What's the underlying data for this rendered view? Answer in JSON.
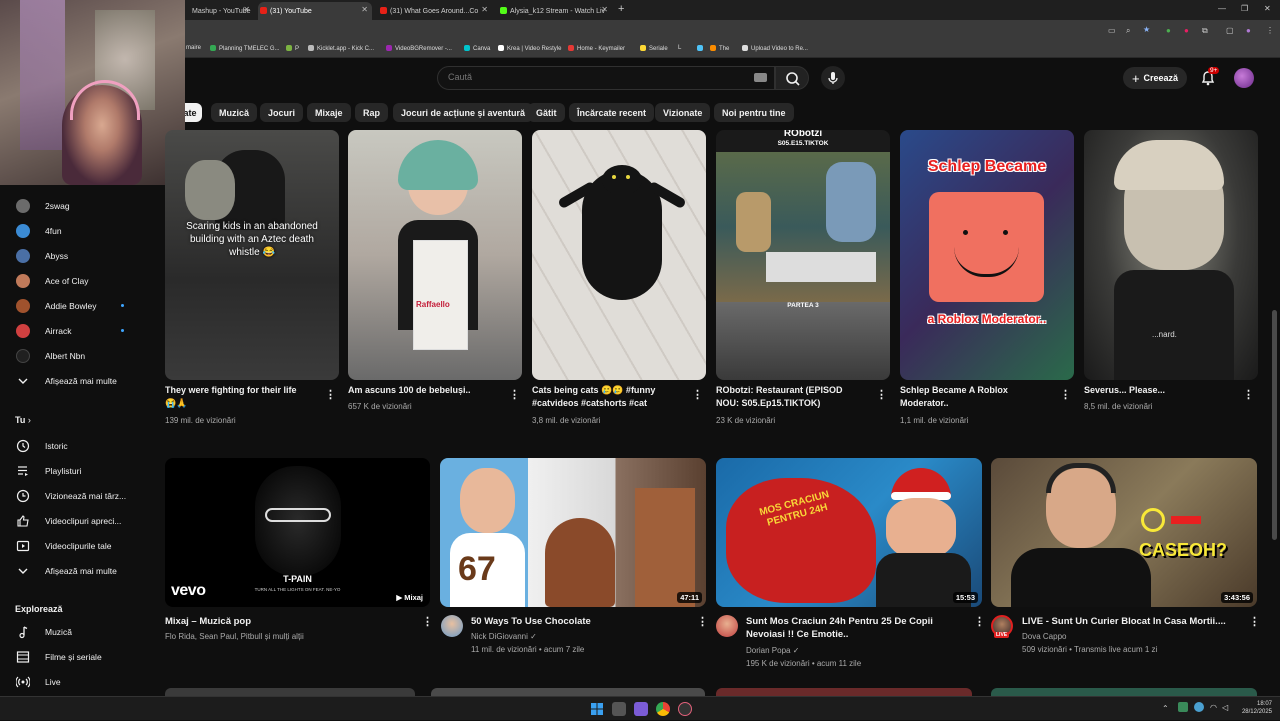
{
  "browser": {
    "tabs": [
      {
        "label": "Mashup - YouTube",
        "active": false
      },
      {
        "label": "(31) YouTube",
        "active": true
      },
      {
        "label": "(31) What Goes Around...Co",
        "active": false
      },
      {
        "label": "Alysia_k12 Stream - Watch Liv",
        "active": false
      }
    ],
    "new_tab": "+",
    "bookmarks": [
      "maire",
      "Planning TMELEC G...",
      "P",
      "Kicklet.app - Kick C...",
      "VideoBGRemover -...",
      "Canva",
      "Krea | Video Restyle",
      "Home - Keymailer",
      "Seriale",
      "L",
      "The",
      "Upload Video to Re..."
    ]
  },
  "youtube": {
    "search": {
      "placeholder": "Caută"
    },
    "create_label": "Creează",
    "notifications_badge": "9+",
    "chips": [
      "ate",
      "Muzică",
      "Jocuri",
      "Mixaje",
      "Rap",
      "Jocuri de acțiune și aventură",
      "Gătit",
      "Încărcate recent",
      "Vizionate",
      "Noi pentru tine"
    ]
  },
  "sidebar": {
    "subscriptions": [
      {
        "label": "2swag",
        "color": "#6b6b6b",
        "dot": false
      },
      {
        "label": "4fun",
        "color": "#3b8bd4",
        "dot": false
      },
      {
        "label": "Abyss",
        "color": "#4a6fa5",
        "dot": false
      },
      {
        "label": "Ace of Clay",
        "color": "#c07a5a",
        "dot": false
      },
      {
        "label": "Addie Bowley",
        "color": "#a0522d",
        "dot": true
      },
      {
        "label": "Airrack",
        "color": "#d04040",
        "dot": true
      },
      {
        "label": "Albert Nbn",
        "color": "#202020",
        "dot": false
      }
    ],
    "show_more": "Afișează mai multe",
    "you_heading": "Tu",
    "you_items": [
      "Istoric",
      "Playlisturi",
      "Vizionează mai târz...",
      "Videoclipuri apreci...",
      "Videoclipurile tale"
    ],
    "show_more_2": "Afișează mai multe",
    "explore_heading": "Explorează",
    "explore_items": [
      "Muzică",
      "Filme și seriale",
      "Live"
    ]
  },
  "shorts": [
    {
      "title": "They were fighting for their life 😭🙏",
      "views": "139 mil. de vizionări",
      "overlay": "Scaring kids in an abandoned building with an Aztec death whistle 😂"
    },
    {
      "title": "Am ascuns 100 de bebeluși..",
      "views": "657 K de vizionări"
    },
    {
      "title": "Cats being cats 🥲🥲 #funny #catvideos #catshorts #cat",
      "views": "3,8 mil. de vizionări"
    },
    {
      "title": "RObotzi: Restaurant (EPISOD NOU: S05.Ep15.TIKTOK)",
      "views": "23 K de vizionări",
      "overlay_top": "RObotzi",
      "overlay_sub": "S05.E15.TIKTOK",
      "overlay_mid": "PARTEA 3"
    },
    {
      "title": "Schlep Became A Roblox Moderator..",
      "views": "1,1 mil. de vizionări",
      "overlay_top": "Schlep Became",
      "overlay_bottom": "a Roblox Moderator.."
    },
    {
      "title": "Severus... Please...",
      "views": "8,5 mil. de vizionări",
      "overlay": "...nard."
    }
  ],
  "videos": [
    {
      "title": "Mixaj – Muzică pop",
      "line1": "Flo Rida, Sean Paul, Pitbull și mulți alții",
      "line2": "",
      "badge": "Mixaj",
      "thumb_text": "T-PAIN",
      "thumb_sub": "TURN ALL THE LIGHTS ON FEAT. NE-YO",
      "brand": "vevo"
    },
    {
      "title": "50 Ways To Use Chocolate",
      "line1": "Nick DiGiovanni ✓",
      "line2": "11 mil. de vizionări • acum 7 zile",
      "duration": "47:11",
      "thumb_text": "67"
    },
    {
      "title": "Sunt Mos Craciun 24h Pentru 25 De Copii Nevoiasi !! Ce Emotie..",
      "line1": "Dorian Popa ✓",
      "line2": "195 K de vizionări • acum 11 zile",
      "duration": "15:53",
      "thumb_text": "MOS CRACIUN PENTRU 24H"
    },
    {
      "title": "LIVE - Sunt Un Curier Blocat In Casa Mortii....",
      "line1": "Dova Cappo",
      "line2": "509 vizionări • Transmis live acum 1 zi",
      "duration": "3:43:56",
      "thumb_text": "CASEOH?",
      "live": "LIVE"
    }
  ],
  "taskbar": {
    "time": "18:07",
    "date": "28/12/2025"
  }
}
